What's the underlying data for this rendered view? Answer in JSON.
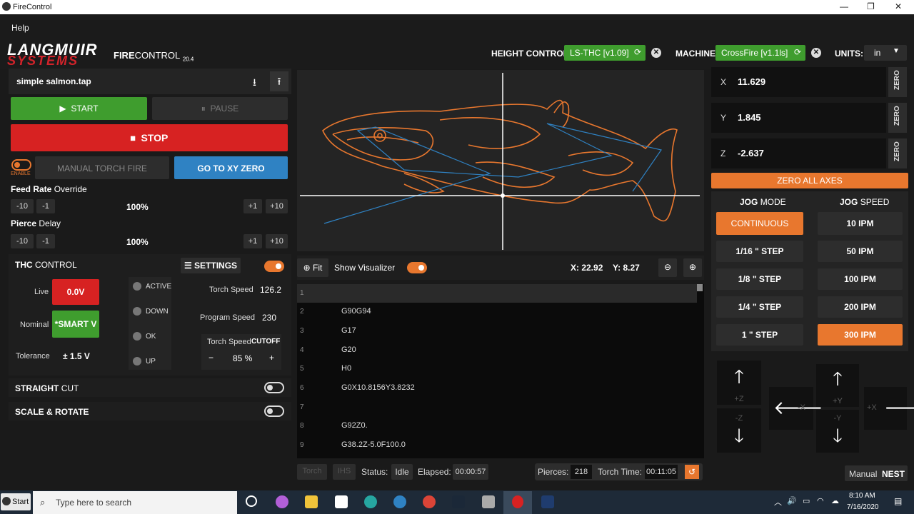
{
  "window": {
    "title": "FireControl",
    "min": "—",
    "max": "❐",
    "close": "✕"
  },
  "menu": {
    "help": "Help"
  },
  "header": {
    "logo_top": "LANGMUIR",
    "logo_bottom": "SYSTEMS",
    "app_fire": "FIRE",
    "app_control": "CONTROL",
    "app_version": "20.4",
    "height_control_label": "HEIGHT CONTROL:",
    "height_control_value": "LS-THC  [v1.09]",
    "machine_label": "MACHINE:",
    "machine_value": "CrossFire  [v1.1ls]",
    "units_label": "UNITS:",
    "units_value": "in"
  },
  "file": {
    "name": "simple salmon.tap"
  },
  "controls": {
    "start": "START",
    "pause": "PAUSE",
    "stop": "STOP",
    "enable": "ENABLE",
    "manual_torch": "MANUAL TORCH FIRE",
    "go_xy_zero": "GO TO XY ZERO"
  },
  "feed": {
    "title_bold": "Feed Rate",
    "title_rest": "Override",
    "minus10": "-10",
    "minus1": "-1",
    "value": "100%",
    "plus1": "+1",
    "plus10": "+10"
  },
  "pierce": {
    "title_bold": "Pierce",
    "title_rest": "Delay",
    "minus10": "-10",
    "minus1": "-1",
    "value": "100%",
    "plus1": "+1",
    "plus10": "+10"
  },
  "thc": {
    "title_bold": "THC",
    "title_rest": "CONTROL",
    "settings": "SETTINGS",
    "live_label": "Live",
    "live_value": "0.0V",
    "nominal_label": "Nominal",
    "nominal_value": "*SMART V",
    "tolerance_label": "Tolerance",
    "tolerance_value": "± 1.5  V",
    "states": [
      "ACTIVE",
      "DOWN",
      "OK",
      "UP"
    ],
    "torch_speed_label": "Torch Speed",
    "torch_speed_value": "126.2",
    "program_speed_label": "Program Speed",
    "program_speed_value": "230",
    "cutoff_label": "Torch Speed",
    "cutoff_bold": "CUTOFF",
    "cutoff_minus": "−",
    "cutoff_value": "85 %",
    "cutoff_plus": "+"
  },
  "straight_cut": {
    "bold": "STRAIGHT",
    "rest": "CUT"
  },
  "scale_rotate": {
    "bold": "SCALE & ROTATE"
  },
  "visualizer": {
    "fit": "Fit",
    "show": "Show Visualizer",
    "x": "X: 22.92",
    "y": "Y: 8.27"
  },
  "code": {
    "lines": [
      {
        "n": "1",
        "c": ""
      },
      {
        "n": "2",
        "c": "G90G94"
      },
      {
        "n": "3",
        "c": "G17"
      },
      {
        "n": "4",
        "c": "G20"
      },
      {
        "n": "5",
        "c": "H0"
      },
      {
        "n": "6",
        "c": "G0X10.8156Y3.8232"
      },
      {
        "n": "7",
        "c": ""
      },
      {
        "n": "8",
        "c": "G92Z0."
      },
      {
        "n": "9",
        "c": "G38.2Z-5.0F100.0"
      }
    ]
  },
  "status": {
    "torch": "Torch",
    "ihs": "IHS",
    "status_label": "Status:",
    "status_value": "Idle",
    "elapsed_label": "Elapsed:",
    "elapsed_value": "00:00:57",
    "pierces_label": "Pierces:",
    "pierces_value": "218",
    "torch_time_label": "Torch Time:",
    "torch_time_value": "00:11:05"
  },
  "axes": {
    "x_label": "X",
    "x_value": "11.629",
    "y_label": "Y",
    "y_value": "1.845",
    "z_label": "Z",
    "z_value": "-2.637",
    "zero": "ZERO",
    "zero_all": "ZERO ALL AXES"
  },
  "jog": {
    "mode_bold": "JOG",
    "mode_rest": "MODE",
    "speed_bold": "JOG",
    "speed_rest": "SPEED",
    "modes": [
      "CONTINUOUS",
      "1/16 \" STEP",
      "1/8 \" STEP",
      "1/4 \" STEP",
      "1 \" STEP"
    ],
    "speeds": [
      "10 IPM",
      "50 IPM",
      "100 IPM",
      "200 IPM",
      "300 IPM"
    ],
    "pz": "+Z",
    "mz": "-Z",
    "py": "+Y",
    "my": "-Y",
    "mx": "-X",
    "px": "+X"
  },
  "footer": {
    "manual": "Manual",
    "nest": "NEST"
  },
  "taskbar": {
    "start": "Start",
    "search_placeholder": "Type here to search",
    "time": "8:10 AM",
    "date": "7/16/2020"
  },
  "colors": {
    "accent": "#e8772e",
    "green": "#3f9d2e",
    "red": "#d72222",
    "blue": "#2f82c3"
  }
}
